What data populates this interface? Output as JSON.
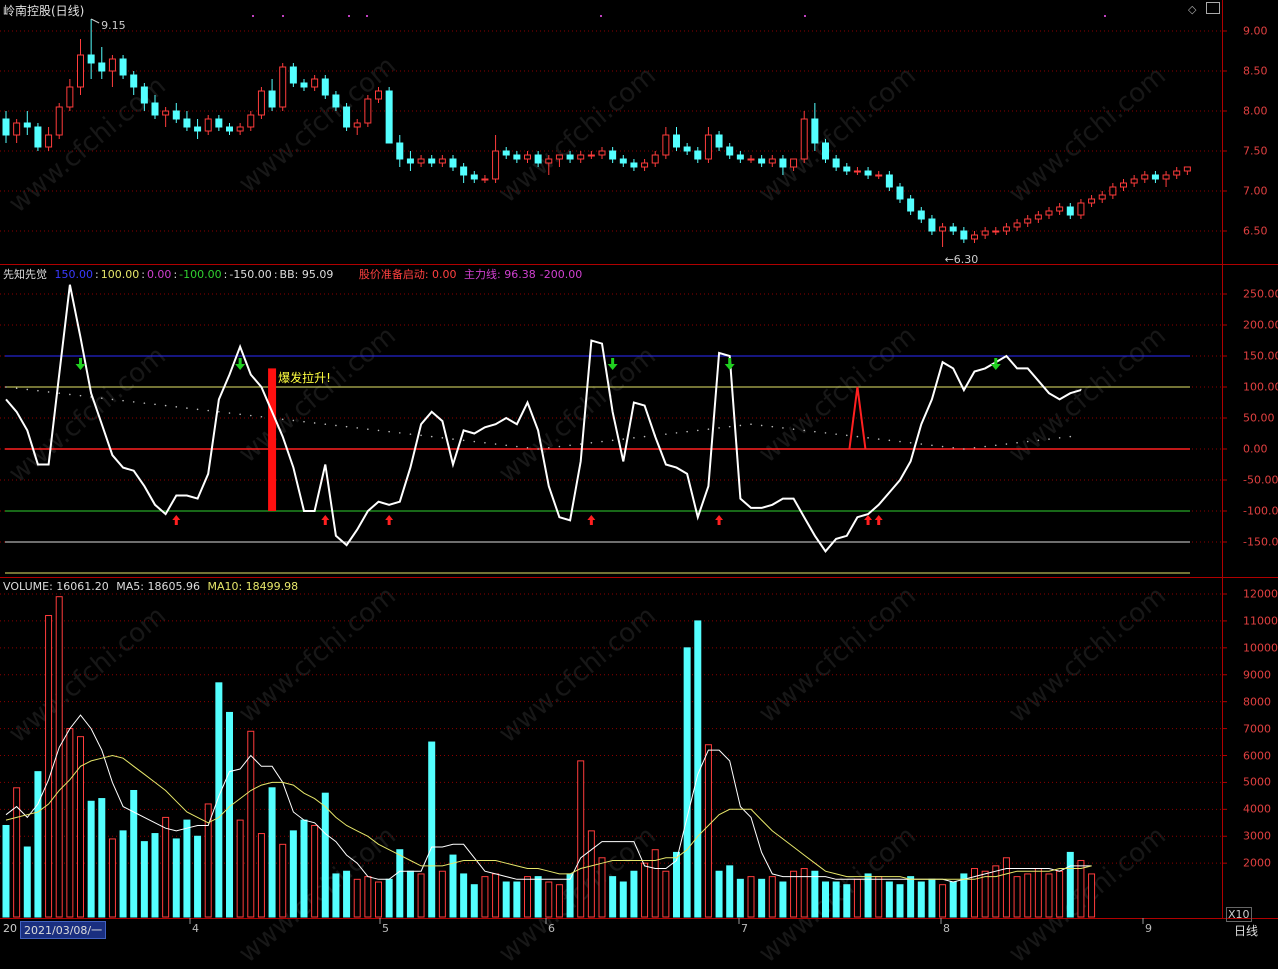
{
  "price_panel": {
    "title": "岭南控股(日线)",
    "high_label": "9.15",
    "low_label": "6.30",
    "ticks": [
      "9.00",
      "8.50",
      "8.00",
      "7.50",
      "7.00",
      "6.50"
    ]
  },
  "indicator_panel": {
    "name": "先知先觉",
    "params": [
      {
        "text": "150.00",
        "color": "#3a3aff"
      },
      {
        "text": "100.00",
        "color": "#e6e66a"
      },
      {
        "text": "0.00",
        "color": "#d040d0"
      },
      {
        "text": "-100.00",
        "color": "#30d030"
      },
      {
        "text": "-150.00",
        "color": "#dddddd"
      },
      {
        "text": "BB: 95.09",
        "color": "#dddddd"
      }
    ],
    "start_label": "股价准备启动: 0.00",
    "main_line_label": "主力线: 96.38",
    "main_line_extra": "-200.00",
    "annotation": "爆发拉升!",
    "ticks": [
      "250.00",
      "200.00",
      "150.00",
      "100.00",
      "50.00",
      "0.00",
      "-50.00",
      "-100.00",
      "-150.00"
    ]
  },
  "volume_panel": {
    "volume_label": "VOLUME: 16061.20",
    "ma5_label": "MA5: 18605.96",
    "ma10_label": "MA10: 18499.98",
    "ticks": [
      "12000",
      "11000",
      "10000",
      "9000",
      "8000",
      "7000",
      "6000",
      "5000",
      "4000",
      "3000",
      "2000"
    ],
    "unit": "X10"
  },
  "footer": {
    "date_box": "2021/03/08/一",
    "period": "日线",
    "year_prefix": "20",
    "months": [
      "4",
      "5",
      "6",
      "7",
      "8",
      "9"
    ]
  },
  "watermark": "www.cfchi.com",
  "colors": {
    "up": "#ff3c3c",
    "down": "#54ffff",
    "grid": "#8b0000",
    "axis": "#b00000"
  },
  "chart_data": [
    {
      "type": "candlestick",
      "title": "岭南控股(日线)",
      "ylim": [
        6.3,
        9.15
      ],
      "candles": [
        [
          7.9,
          8.0,
          7.6,
          7.7
        ],
        [
          7.7,
          7.9,
          7.6,
          7.85
        ],
        [
          7.85,
          8.0,
          7.7,
          7.8
        ],
        [
          7.8,
          7.85,
          7.5,
          7.55
        ],
        [
          7.55,
          7.8,
          7.5,
          7.7
        ],
        [
          7.7,
          8.1,
          7.65,
          8.05
        ],
        [
          8.05,
          8.4,
          8.0,
          8.3
        ],
        [
          8.3,
          8.9,
          8.2,
          8.7
        ],
        [
          8.7,
          9.15,
          8.4,
          8.6
        ],
        [
          8.6,
          8.8,
          8.4,
          8.5
        ],
        [
          8.5,
          8.7,
          8.3,
          8.65
        ],
        [
          8.65,
          8.7,
          8.4,
          8.45
        ],
        [
          8.45,
          8.5,
          8.2,
          8.3
        ],
        [
          8.3,
          8.35,
          8.0,
          8.1
        ],
        [
          8.1,
          8.2,
          7.9,
          7.95
        ],
        [
          7.95,
          8.05,
          7.8,
          8.0
        ],
        [
          8.0,
          8.1,
          7.85,
          7.9
        ],
        [
          7.9,
          8.0,
          7.75,
          7.8
        ],
        [
          7.8,
          7.9,
          7.65,
          7.75
        ],
        [
          7.75,
          7.95,
          7.7,
          7.9
        ],
        [
          7.9,
          7.95,
          7.75,
          7.8
        ],
        [
          7.8,
          7.85,
          7.7,
          7.75
        ],
        [
          7.75,
          7.85,
          7.7,
          7.8
        ],
        [
          7.8,
          8.0,
          7.75,
          7.95
        ],
        [
          7.95,
          8.3,
          7.9,
          8.25
        ],
        [
          8.25,
          8.4,
          8.0,
          8.05
        ],
        [
          8.05,
          8.6,
          8.0,
          8.55
        ],
        [
          8.55,
          8.6,
          8.3,
          8.35
        ],
        [
          8.35,
          8.4,
          8.25,
          8.3
        ],
        [
          8.3,
          8.45,
          8.25,
          8.4
        ],
        [
          8.4,
          8.45,
          8.15,
          8.2
        ],
        [
          8.2,
          8.25,
          8.0,
          8.05
        ],
        [
          8.05,
          8.1,
          7.75,
          7.8
        ],
        [
          7.8,
          7.9,
          7.7,
          7.85
        ],
        [
          7.85,
          8.2,
          7.8,
          8.15
        ],
        [
          8.15,
          8.3,
          8.1,
          8.25
        ],
        [
          8.25,
          8.3,
          7.7,
          7.6
        ],
        [
          7.6,
          7.7,
          7.3,
          7.4
        ],
        [
          7.4,
          7.5,
          7.25,
          7.35
        ],
        [
          7.35,
          7.45,
          7.3,
          7.4
        ],
        [
          7.4,
          7.45,
          7.3,
          7.35
        ],
        [
          7.35,
          7.45,
          7.3,
          7.4
        ],
        [
          7.4,
          7.45,
          7.25,
          7.3
        ],
        [
          7.3,
          7.35,
          7.1,
          7.2
        ],
        [
          7.2,
          7.25,
          7.1,
          7.15
        ],
        [
          7.15,
          7.2,
          7.1,
          7.15
        ],
        [
          7.15,
          7.7,
          7.1,
          7.5
        ],
        [
          7.5,
          7.55,
          7.4,
          7.45
        ],
        [
          7.45,
          7.5,
          7.35,
          7.4
        ],
        [
          7.4,
          7.5,
          7.35,
          7.45
        ],
        [
          7.45,
          7.5,
          7.3,
          7.35
        ],
        [
          7.35,
          7.45,
          7.2,
          7.4
        ],
        [
          7.4,
          7.45,
          7.3,
          7.45
        ],
        [
          7.45,
          7.5,
          7.35,
          7.4
        ],
        [
          7.4,
          7.5,
          7.35,
          7.45
        ],
        [
          7.45,
          7.5,
          7.4,
          7.45
        ],
        [
          7.45,
          7.55,
          7.4,
          7.5
        ],
        [
          7.5,
          7.55,
          7.35,
          7.4
        ],
        [
          7.4,
          7.45,
          7.3,
          7.35
        ],
        [
          7.35,
          7.4,
          7.25,
          7.3
        ],
        [
          7.3,
          7.4,
          7.25,
          7.35
        ],
        [
          7.35,
          7.5,
          7.3,
          7.45
        ],
        [
          7.45,
          7.8,
          7.4,
          7.7
        ],
        [
          7.7,
          7.8,
          7.5,
          7.55
        ],
        [
          7.55,
          7.6,
          7.45,
          7.5
        ],
        [
          7.5,
          7.55,
          7.35,
          7.4
        ],
        [
          7.4,
          7.8,
          7.35,
          7.7
        ],
        [
          7.7,
          7.75,
          7.5,
          7.55
        ],
        [
          7.55,
          7.6,
          7.4,
          7.45
        ],
        [
          7.45,
          7.5,
          7.35,
          7.4
        ],
        [
          7.4,
          7.45,
          7.35,
          7.4
        ],
        [
          7.4,
          7.45,
          7.3,
          7.35
        ],
        [
          7.35,
          7.45,
          7.3,
          7.4
        ],
        [
          7.4,
          7.45,
          7.2,
          7.3
        ],
        [
          7.3,
          7.4,
          7.25,
          7.4
        ],
        [
          7.4,
          8.0,
          7.35,
          7.9
        ],
        [
          7.9,
          8.1,
          7.5,
          7.6
        ],
        [
          7.6,
          7.65,
          7.35,
          7.4
        ],
        [
          7.4,
          7.45,
          7.25,
          7.3
        ],
        [
          7.3,
          7.35,
          7.2,
          7.25
        ],
        [
          7.25,
          7.3,
          7.2,
          7.25
        ],
        [
          7.25,
          7.3,
          7.15,
          7.2
        ],
        [
          7.2,
          7.25,
          7.15,
          7.2
        ],
        [
          7.2,
          7.25,
          7.0,
          7.05
        ],
        [
          7.05,
          7.1,
          6.85,
          6.9
        ],
        [
          6.9,
          6.95,
          6.7,
          6.75
        ],
        [
          6.75,
          6.8,
          6.6,
          6.65
        ],
        [
          6.65,
          6.7,
          6.45,
          6.5
        ],
        [
          6.5,
          6.6,
          6.3,
          6.55
        ],
        [
          6.55,
          6.6,
          6.45,
          6.5
        ],
        [
          6.5,
          6.55,
          6.35,
          6.4
        ],
        [
          6.4,
          6.5,
          6.35,
          6.45
        ],
        [
          6.45,
          6.55,
          6.4,
          6.5
        ],
        [
          6.5,
          6.55,
          6.45,
          6.5
        ],
        [
          6.5,
          6.6,
          6.45,
          6.55
        ],
        [
          6.55,
          6.65,
          6.5,
          6.6
        ],
        [
          6.6,
          6.7,
          6.55,
          6.65
        ],
        [
          6.65,
          6.75,
          6.6,
          6.7
        ],
        [
          6.7,
          6.8,
          6.65,
          6.75
        ],
        [
          6.75,
          6.85,
          6.7,
          6.8
        ],
        [
          6.8,
          6.85,
          6.65,
          6.7
        ],
        [
          6.7,
          6.9,
          6.65,
          6.85
        ],
        [
          6.85,
          6.95,
          6.8,
          6.9
        ],
        [
          6.9,
          7.0,
          6.85,
          6.95
        ],
        [
          6.95,
          7.1,
          6.9,
          7.05
        ],
        [
          7.05,
          7.15,
          7.0,
          7.1
        ],
        [
          7.1,
          7.2,
          7.05,
          7.15
        ],
        [
          7.15,
          7.25,
          7.1,
          7.2
        ],
        [
          7.2,
          7.25,
          7.1,
          7.15
        ],
        [
          7.15,
          7.25,
          7.05,
          7.2
        ],
        [
          7.2,
          7.3,
          7.15,
          7.25
        ],
        [
          7.25,
          7.3,
          7.2,
          7.3
        ]
      ]
    },
    {
      "type": "line",
      "title": "先知先觉",
      "ylim": [
        -200,
        270
      ],
      "reference_lines": [
        150,
        100,
        0,
        -100,
        -150,
        -200
      ],
      "values": [
        80,
        60,
        30,
        -25,
        -25,
        120,
        265,
        180,
        90,
        40,
        -10,
        -30,
        -35,
        -60,
        -90,
        -105,
        -75,
        -75,
        -80,
        -40,
        80,
        120,
        165,
        120,
        100,
        60,
        20,
        -30,
        -100,
        -100,
        -25,
        -140,
        -155,
        -130,
        -100,
        -85,
        -90,
        -85,
        -30,
        40,
        60,
        45,
        -25,
        30,
        25,
        35,
        40,
        50,
        40,
        75,
        30,
        -60,
        -110,
        -115,
        -20,
        175,
        170,
        60,
        -20,
        75,
        70,
        20,
        -25,
        -30,
        -40,
        -110,
        -60,
        155,
        150,
        -80,
        -95,
        -95,
        -90,
        -80,
        -80,
        -110,
        -140,
        -165,
        -145,
        -140,
        -110,
        -105,
        -90,
        -70,
        -50,
        -20,
        40,
        80,
        140,
        130,
        95,
        125,
        130,
        140,
        150,
        130,
        130,
        110,
        90,
        80,
        90,
        95
      ],
      "main_line_values": [
        100,
        98,
        96,
        94,
        92,
        90,
        88,
        86,
        84,
        82,
        80,
        78,
        76,
        74,
        72,
        70,
        68,
        66,
        64,
        62,
        60,
        58,
        56,
        54,
        52,
        50,
        48,
        46,
        44,
        42,
        40,
        38,
        36,
        34,
        32,
        30,
        28,
        26,
        24,
        22,
        20,
        18,
        16,
        14,
        12,
        10,
        8,
        6,
        4,
        2,
        0,
        2,
        4,
        6,
        8,
        10,
        12,
        14,
        16,
        18,
        20,
        22,
        24,
        26,
        28,
        30,
        32,
        34,
        36,
        38,
        40,
        38,
        36,
        34,
        32,
        30,
        28,
        26,
        24,
        22,
        20,
        18,
        16,
        14,
        12,
        10,
        8,
        6,
        4,
        2,
        0,
        2,
        4,
        6,
        8,
        10,
        12,
        14,
        16,
        18,
        20,
        96
      ],
      "start_signal": {
        "index": 80,
        "value": 100
      },
      "burst_bar": {
        "index": 25,
        "top": 130,
        "bottom": -100
      },
      "up_arrows": [
        16,
        30,
        36,
        55,
        67,
        81,
        82
      ],
      "down_arrows": [
        7,
        22,
        57,
        68,
        93
      ]
    },
    {
      "type": "bar",
      "title": "VOLUME",
      "ylim": [
        0,
        12000
      ],
      "values": [
        3400,
        4800,
        2600,
        5400,
        11200,
        11900,
        7000,
        6700,
        4300,
        4400,
        2900,
        3200,
        4700,
        2800,
        3100,
        3700,
        2900,
        3600,
        3000,
        4200,
        8700,
        7600,
        3600,
        6900,
        3100,
        4800,
        2700,
        3200,
        3600,
        3400,
        4600,
        1600,
        1700,
        1400,
        1500,
        1300,
        1400,
        2500,
        1700,
        1600,
        6500,
        1700,
        2300,
        1600,
        1200,
        1500,
        1600,
        1300,
        1300,
        1500,
        1500,
        1300,
        1200,
        1600,
        5800,
        3200,
        2200,
        1500,
        1300,
        1700,
        2000,
        2500,
        1700,
        2400,
        10000,
        11000,
        6400,
        1700,
        1900,
        1400,
        1500,
        1400,
        1500,
        1300,
        1700,
        1800,
        1700,
        1300,
        1300,
        1200,
        1400,
        1600,
        1500,
        1300,
        1200,
        1500,
        1300,
        1400,
        1200,
        1300,
        1600,
        1800,
        1700,
        1900,
        2200,
        1500,
        1600,
        1800,
        1600,
        1700,
        2400,
        2100,
        1600
      ],
      "ma5": [
        3800,
        4100,
        3700,
        4200,
        5100,
        6300,
        7000,
        7500,
        7000,
        6200,
        5000,
        4100,
        3900,
        3700,
        3500,
        3300,
        3200,
        3300,
        3400,
        3400,
        4500,
        5400,
        5500,
        6000,
        5600,
        5600,
        5000,
        3900,
        3600,
        3500,
        3100,
        2800,
        2300,
        2000,
        1500,
        1400,
        1400,
        1700,
        1700,
        1700,
        2600,
        2600,
        2700,
        2700,
        2200,
        1700,
        1600,
        1500,
        1400,
        1400,
        1400,
        1400,
        1400,
        1400,
        2200,
        2500,
        2800,
        2800,
        2800,
        2800,
        1900,
        1800,
        1800,
        2100,
        3700,
        5300,
        6200,
        6200,
        5800,
        4100,
        3700,
        2400,
        1600,
        1500,
        1500,
        1500,
        1500,
        1500,
        1400,
        1400,
        1400,
        1400,
        1400,
        1400,
        1400,
        1400,
        1400,
        1400,
        1400,
        1300,
        1400,
        1500,
        1600,
        1700,
        1800,
        1800,
        1800,
        1800,
        1800,
        1700,
        1900,
        1900,
        1900
      ],
      "ma10": [
        3600,
        3700,
        3800,
        3900,
        4200,
        4700,
        5100,
        5600,
        5800,
        5900,
        6000,
        5900,
        5600,
        5300,
        5000,
        4700,
        4300,
        3900,
        3700,
        3500,
        3700,
        4100,
        4400,
        4700,
        4900,
        5000,
        5000,
        4900,
        4600,
        4400,
        4100,
        3700,
        3400,
        3200,
        3000,
        2700,
        2500,
        2300,
        2100,
        1900,
        1900,
        1900,
        2000,
        2100,
        2100,
        2100,
        2100,
        2000,
        1900,
        1800,
        1800,
        1700,
        1600,
        1600,
        1800,
        1900,
        2000,
        2100,
        2100,
        2100,
        2100,
        2100,
        2200,
        2200,
        2500,
        3000,
        3400,
        3800,
        4000,
        4000,
        4000,
        3600,
        3200,
        2900,
        2600,
        2300,
        2000,
        1700,
        1600,
        1500,
        1500,
        1500,
        1500,
        1500,
        1500,
        1400,
        1400,
        1400,
        1400,
        1400,
        1400,
        1400,
        1500,
        1500,
        1600,
        1700,
        1700,
        1700,
        1700,
        1800,
        1800,
        1800,
        1900
      ]
    }
  ]
}
